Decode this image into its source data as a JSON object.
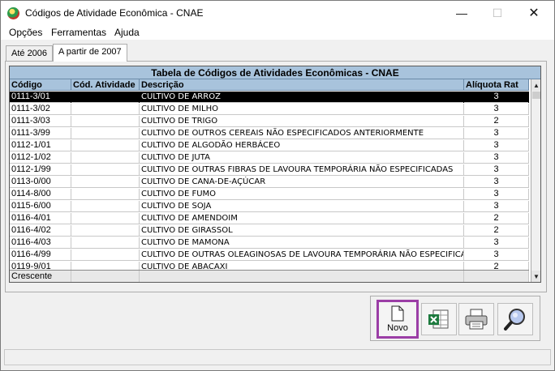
{
  "window": {
    "title": "Códigos de Atividade Econômica - CNAE",
    "controls": {
      "minimize": "—",
      "maximize": "☐",
      "close": "✕"
    }
  },
  "menu": [
    "Opções",
    "Ferramentas",
    "Ajuda"
  ],
  "tabs": [
    {
      "label": "Até 2006",
      "active": false
    },
    {
      "label": "A partir de 2007",
      "active": true
    }
  ],
  "grid": {
    "title": "Tabela de Códigos de Atividades Econômicas - CNAE",
    "columns": [
      "Código",
      "Cód. Atividade",
      "Descrição",
      "Alíquota Rat"
    ],
    "rows": [
      {
        "codigo": "0111-3/01",
        "atividade": "",
        "descricao": "CULTIVO DE ARROZ",
        "rat": "3",
        "selected": true
      },
      {
        "codigo": "0111-3/02",
        "atividade": "",
        "descricao": "CULTIVO DE MILHO",
        "rat": "3"
      },
      {
        "codigo": "0111-3/03",
        "atividade": "",
        "descricao": "CULTIVO DE TRIGO",
        "rat": "2"
      },
      {
        "codigo": "0111-3/99",
        "atividade": "",
        "descricao": "CULTIVO DE OUTROS CEREAIS NÃO ESPECIFICADOS ANTERIORMENTE",
        "rat": "3"
      },
      {
        "codigo": "0112-1/01",
        "atividade": "",
        "descricao": "CULTIVO DE ALGODÃO HERBÁCEO",
        "rat": "3"
      },
      {
        "codigo": "0112-1/02",
        "atividade": "",
        "descricao": "CULTIVO DE JUTA",
        "rat": "3"
      },
      {
        "codigo": "0112-1/99",
        "atividade": "",
        "descricao": "CULTIVO DE OUTRAS FIBRAS DE LAVOURA TEMPORÁRIA NÃO ESPECIFICADAS",
        "rat": "3"
      },
      {
        "codigo": "0113-0/00",
        "atividade": "",
        "descricao": "CULTIVO DE CANA-DE-AÇÚCAR",
        "rat": "3"
      },
      {
        "codigo": "0114-8/00",
        "atividade": "",
        "descricao": "CULTIVO DE FUMO",
        "rat": "3"
      },
      {
        "codigo": "0115-6/00",
        "atividade": "",
        "descricao": "CULTIVO DE SOJA",
        "rat": "3"
      },
      {
        "codigo": "0116-4/01",
        "atividade": "",
        "descricao": "CULTIVO DE AMENDOIM",
        "rat": "2"
      },
      {
        "codigo": "0116-4/02",
        "atividade": "",
        "descricao": "CULTIVO DE GIRASSOL",
        "rat": "2"
      },
      {
        "codigo": "0116-4/03",
        "atividade": "",
        "descricao": "CULTIVO DE MAMONA",
        "rat": "3"
      },
      {
        "codigo": "0116-4/99",
        "atividade": "",
        "descricao": "CULTIVO DE OUTRAS OLEAGINOSAS DE LAVOURA TEMPORÁRIA NÃO ESPECIFICADAS",
        "rat": "3"
      },
      {
        "codigo": "0119-9/01",
        "atividade": "",
        "descricao": "CULTIVO DE ABACAXI",
        "rat": "2"
      }
    ],
    "footer": {
      "sort_label": "Crescente"
    }
  },
  "toolbar": {
    "novo_label": "Novo",
    "buttons": [
      "new-document-icon",
      "excel-export-icon",
      "printer-icon",
      "search-magnifier-icon"
    ]
  },
  "colors": {
    "grid_header": "#a8c3dc",
    "highlight": "#9b3ea6"
  }
}
